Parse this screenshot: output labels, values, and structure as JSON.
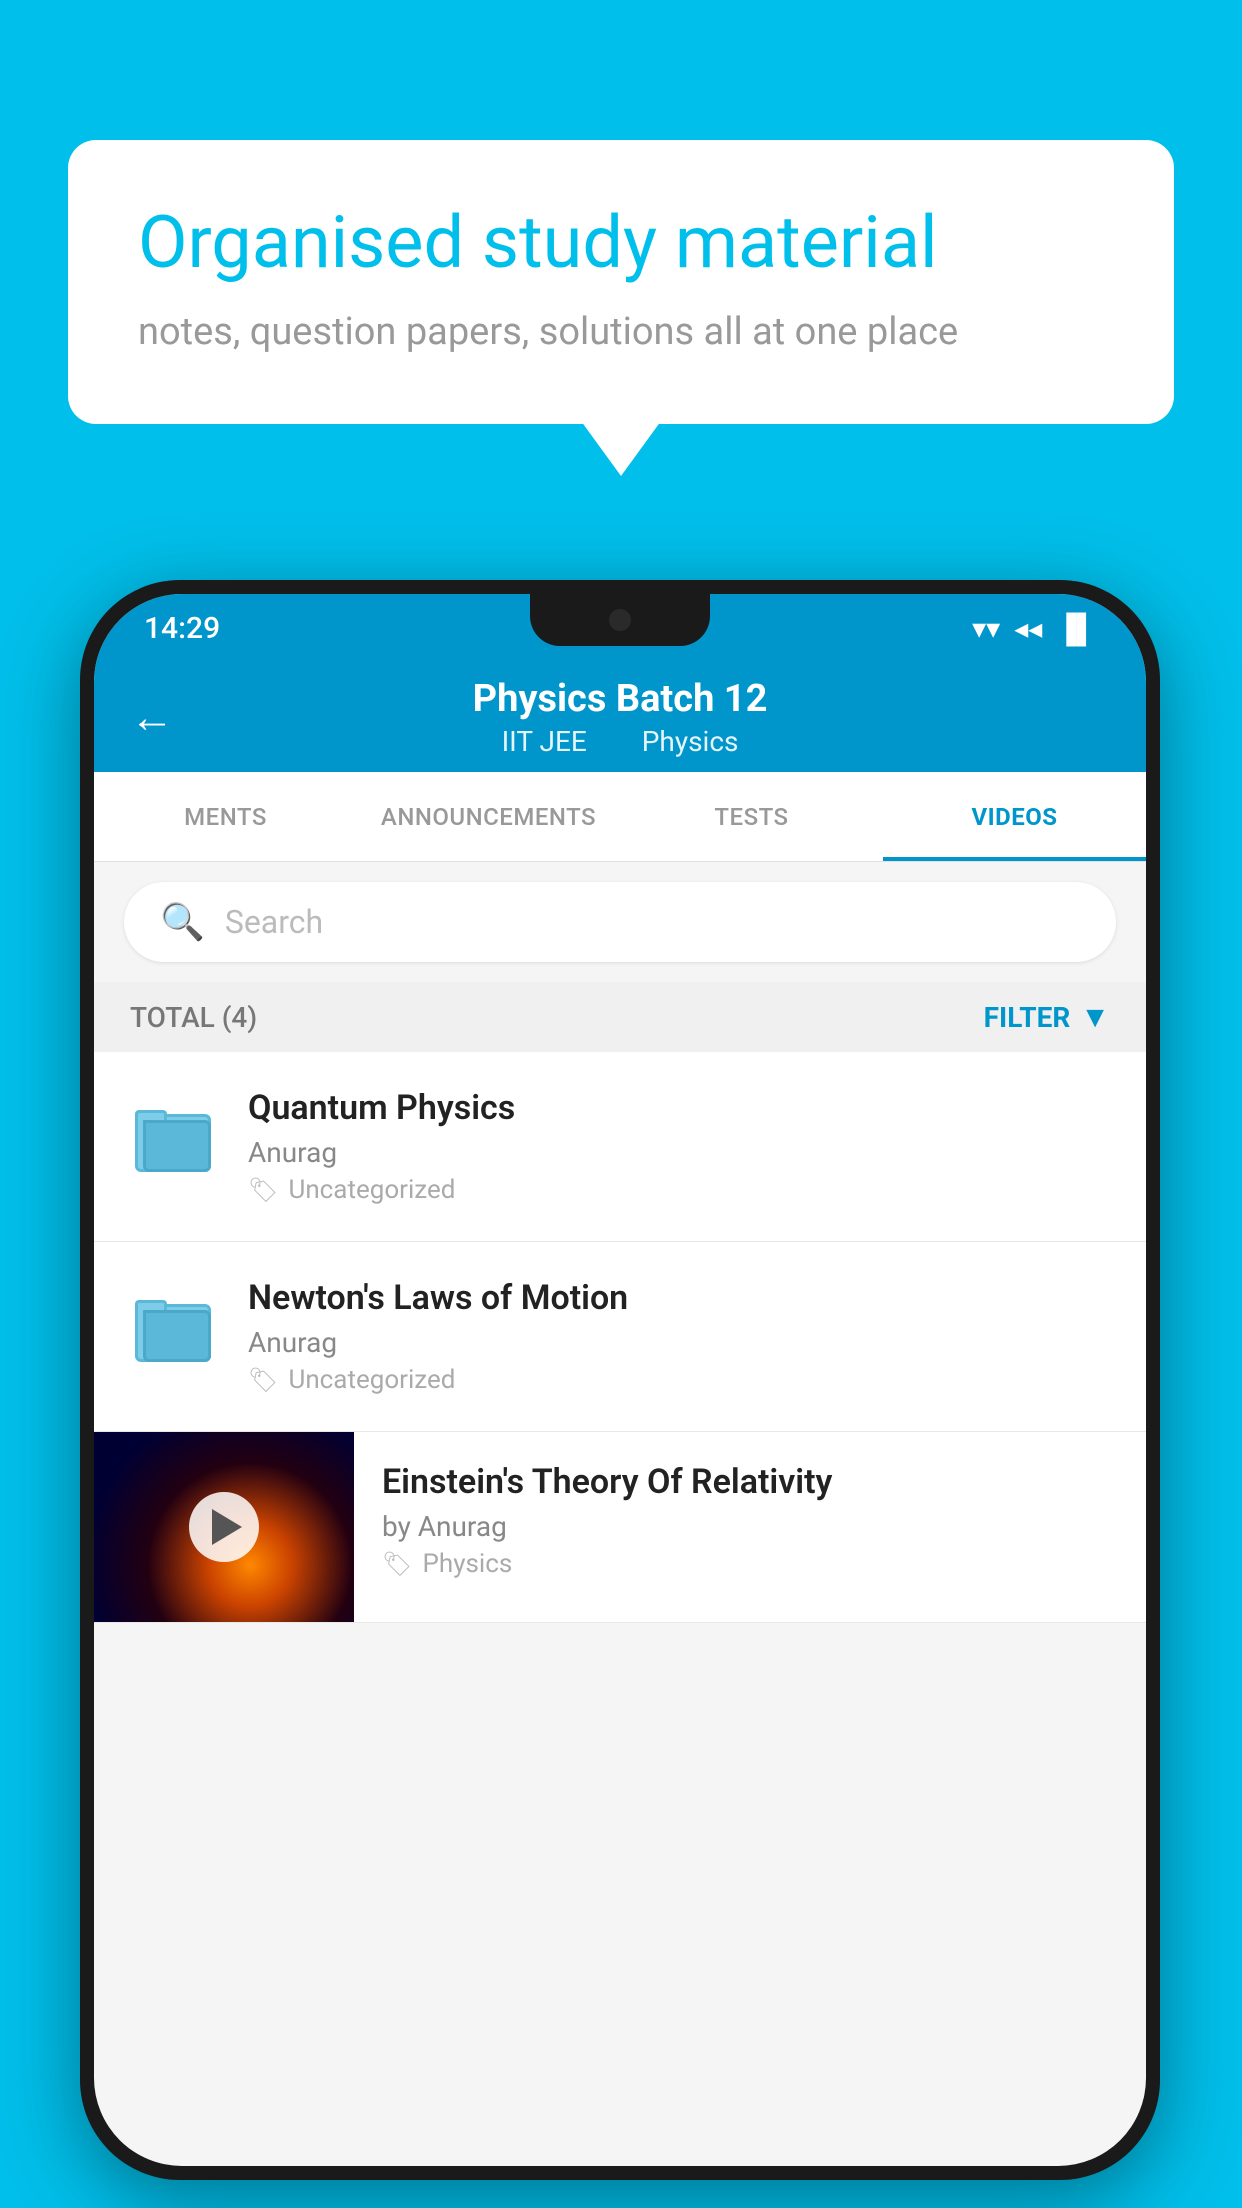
{
  "background_color": "#00BFEA",
  "speech_bubble": {
    "title": "Organised study material",
    "subtitle": "notes, question papers, solutions all at one place"
  },
  "status_bar": {
    "time": "14:29",
    "wifi_icon": "▼",
    "signal_icon": "◀",
    "battery_icon": "▐"
  },
  "toolbar": {
    "back_icon": "←",
    "title": "Physics Batch 12",
    "subtitle_part1": "IIT JEE",
    "subtitle_part2": "Physics"
  },
  "tabs": [
    {
      "label": "MENTS",
      "active": false
    },
    {
      "label": "ANNOUNCEMENTS",
      "active": false
    },
    {
      "label": "TESTS",
      "active": false
    },
    {
      "label": "VIDEOS",
      "active": true
    }
  ],
  "search": {
    "placeholder": "Search",
    "icon": "🔍"
  },
  "filter_bar": {
    "total_label": "TOTAL (4)",
    "filter_label": "FILTER",
    "filter_icon": "▼"
  },
  "video_items": [
    {
      "id": 1,
      "title": "Quantum Physics",
      "author": "Anurag",
      "tag": "Uncategorized",
      "type": "folder"
    },
    {
      "id": 2,
      "title": "Newton's Laws of Motion",
      "author": "Anurag",
      "tag": "Uncategorized",
      "type": "folder"
    },
    {
      "id": 3,
      "title": "Einstein's Theory Of Relativity",
      "author": "by Anurag",
      "tag": "Physics",
      "type": "video"
    }
  ]
}
